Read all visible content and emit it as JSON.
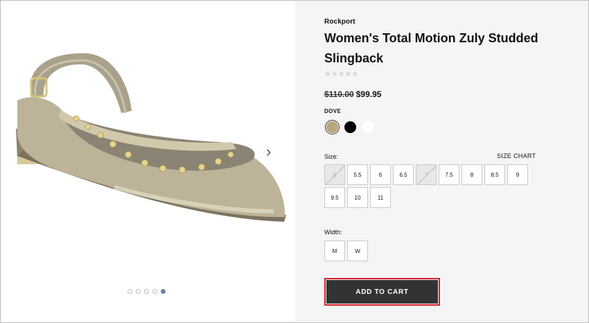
{
  "gallery": {
    "prev_arrow": "‹",
    "next_arrow": "›",
    "dots": [
      false,
      false,
      false,
      false,
      true
    ]
  },
  "product": {
    "brand": "Rockport",
    "title": "Women's Total Motion Zuly Studded Slingback",
    "stars": [
      "★",
      "★",
      "★",
      "★",
      "★"
    ],
    "original_price": "$110.00",
    "sale_price": "$99.95",
    "selected_color": "DOVE",
    "swatches": [
      {
        "name": "dove-swatch",
        "color": "#b9a77e",
        "selected": true
      },
      {
        "name": "black-swatch",
        "color": "#000000",
        "selected": false
      },
      {
        "name": "white-swatch",
        "color": "#ffffff",
        "selected": false
      }
    ]
  },
  "sizes": {
    "label": "Size:",
    "chart_link": "SIZE CHART",
    "options": [
      {
        "label": "5",
        "available": false
      },
      {
        "label": "5.5",
        "available": true
      },
      {
        "label": "6",
        "available": true
      },
      {
        "label": "6.5",
        "available": true
      },
      {
        "label": "7",
        "available": false
      },
      {
        "label": "7.5",
        "available": true
      },
      {
        "label": "8",
        "available": true
      },
      {
        "label": "8.5",
        "available": true
      },
      {
        "label": "9",
        "available": true
      },
      {
        "label": "9.5",
        "available": true
      },
      {
        "label": "10",
        "available": true
      },
      {
        "label": "11",
        "available": true
      }
    ]
  },
  "widths": {
    "label": "Width:",
    "options": [
      "M",
      "W"
    ]
  },
  "cart": {
    "button_label": "ADD TO CART",
    "highlight_color": "#d21f2a"
  }
}
